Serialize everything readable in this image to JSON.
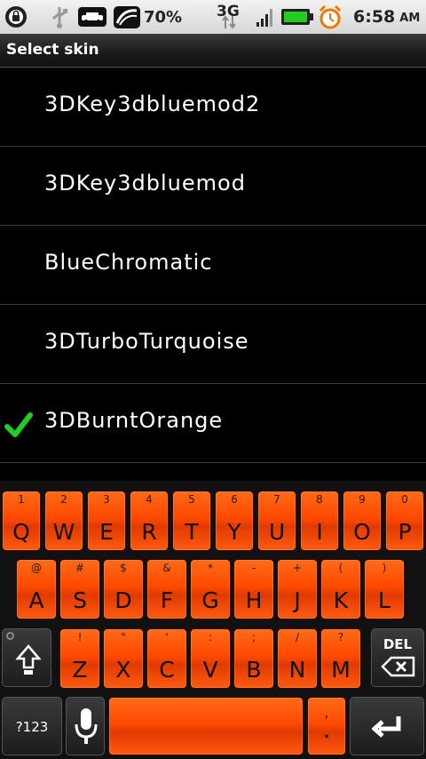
{
  "status_bar": {
    "battery_percent": "70%",
    "network": "3G",
    "time": "6:58",
    "ampm": "AM"
  },
  "title": "Select skin",
  "skins": [
    {
      "name": "3DKey3dbluemod2",
      "selected": false
    },
    {
      "name": "3DKey3dbluemod",
      "selected": false
    },
    {
      "name": "BlueChromatic",
      "selected": false
    },
    {
      "name": "3DTurboTurquoise",
      "selected": false
    },
    {
      "name": "3DBurntOrange",
      "selected": true
    }
  ],
  "keyboard": {
    "row1": [
      {
        "num": "1",
        "letter": "Q"
      },
      {
        "num": "2",
        "letter": "W"
      },
      {
        "num": "3",
        "letter": "E"
      },
      {
        "num": "4",
        "letter": "R"
      },
      {
        "num": "5",
        "letter": "T"
      },
      {
        "num": "6",
        "letter": "Y"
      },
      {
        "num": "7",
        "letter": "U"
      },
      {
        "num": "8",
        "letter": "I"
      },
      {
        "num": "9",
        "letter": "O"
      },
      {
        "num": "0",
        "letter": "P"
      }
    ],
    "row2": [
      {
        "num": "@",
        "letter": "A"
      },
      {
        "num": "#",
        "letter": "S"
      },
      {
        "num": "$",
        "letter": "D"
      },
      {
        "num": "&",
        "letter": "F"
      },
      {
        "num": "*",
        "letter": "G"
      },
      {
        "num": "-",
        "letter": "H"
      },
      {
        "num": "+",
        "letter": "J"
      },
      {
        "num": "(",
        "letter": "K"
      },
      {
        "num": ")",
        "letter": "L"
      }
    ],
    "row3": [
      {
        "num": "!",
        "letter": "Z"
      },
      {
        "num": "\"",
        "letter": "X"
      },
      {
        "num": "'",
        "letter": "C"
      },
      {
        "num": ":",
        "letter": "V"
      },
      {
        "num": ";",
        "letter": "B"
      },
      {
        "num": "/",
        "letter": "N"
      },
      {
        "num": "?",
        "letter": "M"
      }
    ],
    "del_label": "DEL",
    "symbols_label": "?123",
    "period_label": ".",
    "comma_label": ","
  },
  "colors": {
    "key_orange": "#ff4a00",
    "check_green": "#22cc22"
  }
}
